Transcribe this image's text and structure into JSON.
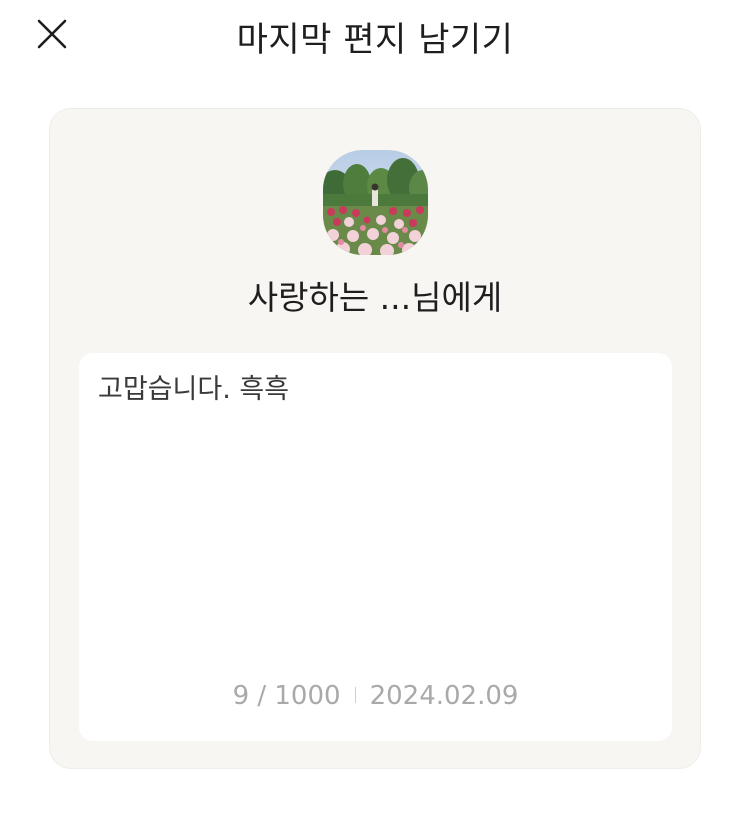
{
  "header": {
    "title": "마지막 편지 남기기",
    "close_icon": "close-icon"
  },
  "letter_card": {
    "avatar_icon": "profile-photo-flower-garden",
    "recipient": "사랑하는 ...님에게",
    "body_text": "고맙습니다. 흑흑",
    "char_count": "9 / 1000",
    "date": "2024.02.09"
  },
  "colors": {
    "card_background": "#f8f6f3",
    "letter_background": "#ffffff",
    "meta_text": "#a9a9a9",
    "title_text": "#1e1e1e"
  }
}
